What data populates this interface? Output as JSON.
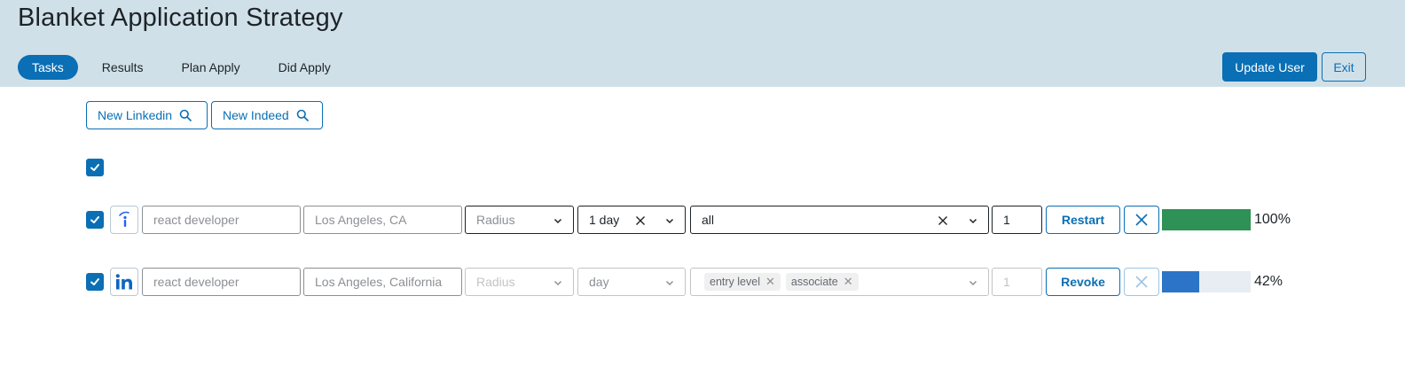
{
  "app": {
    "title": "Blanket Application Strategy"
  },
  "tabs": [
    {
      "label": "Tasks",
      "active": true
    },
    {
      "label": "Results",
      "active": false
    },
    {
      "label": "Plan Apply",
      "active": false
    },
    {
      "label": "Did Apply",
      "active": false
    }
  ],
  "header_actions": {
    "update_user": "Update User",
    "exit": "Exit"
  },
  "search_buttons": {
    "linkedin": "New Linkedin",
    "indeed": "New Indeed"
  },
  "colors": {
    "accent": "#0a6fb5",
    "header_bg": "#d0e0e8",
    "progress_done": "#2e9155",
    "progress_active": "#2c74c7"
  },
  "tasks": [
    {
      "source_icon": "indeed-icon",
      "checked": true,
      "keywords_placeholder": "react developer",
      "location_placeholder": "Los Angeles, CA",
      "radius_placeholder": "Radius",
      "date_posted": "1 day",
      "experience": "all",
      "count": "1",
      "action": "Restart",
      "progress": 100,
      "progress_label": "100%"
    },
    {
      "source_icon": "linkedin-icon",
      "checked": true,
      "keywords_placeholder": "react developer",
      "location_placeholder": "Los Angeles, California",
      "radius_placeholder": "Radius",
      "date_posted_placeholder": "day",
      "experience_tags": [
        "entry level",
        "associate"
      ],
      "count_placeholder": "1",
      "action": "Revoke",
      "progress": 42,
      "progress_label": "42%"
    }
  ]
}
